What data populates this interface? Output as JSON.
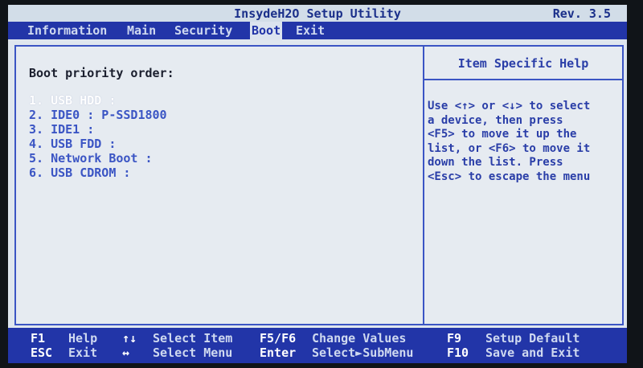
{
  "title": "InsydeH2O Setup Utility",
  "revision": "Rev. 3.5",
  "menu": {
    "tabs": [
      {
        "label": "Information",
        "active": false
      },
      {
        "label": "Main",
        "active": false
      },
      {
        "label": "Security",
        "active": false
      },
      {
        "label": "Boot",
        "active": true
      },
      {
        "label": "Exit",
        "active": false
      }
    ]
  },
  "main": {
    "heading": "Boot priority order:",
    "items": [
      {
        "label": "1. USB HDD :",
        "selected": true
      },
      {
        "label": "2. IDE0 : P-SSD1800",
        "selected": false
      },
      {
        "label": "3. IDE1 :",
        "selected": false
      },
      {
        "label": "4. USB FDD :",
        "selected": false
      },
      {
        "label": "5. Network Boot :",
        "selected": false
      },
      {
        "label": "6. USB CDROM :",
        "selected": false
      }
    ]
  },
  "help": {
    "title": "Item Specific Help",
    "text": "Use <↑> or <↓> to select\na device, then press\n<F5> to move it up the\nlist, or <F6> to move it\ndown the list. Press\n<Esc> to escape the menu"
  },
  "footer": {
    "keys": [
      {
        "key": "F1",
        "desc": "Help"
      },
      {
        "key": "ESC",
        "desc": "Exit"
      },
      {
        "key": "↑↓",
        "desc": "Select Item"
      },
      {
        "key": "↔",
        "desc": "Select Menu"
      },
      {
        "key": "F5/F6",
        "desc": "Change Values"
      },
      {
        "key": "Enter",
        "desc": "Select►SubMenu"
      },
      {
        "key": "F9",
        "desc": "Setup Default"
      },
      {
        "key": "F10",
        "desc": "Save and Exit"
      }
    ]
  },
  "colors": {
    "menu_background": "#2235a8",
    "panel_background": "#e6ebf1",
    "border": "#3b55c4",
    "item_text": "#3b55c4",
    "selected_item_text": "#ffffff",
    "title_text": "#1a2f8a"
  }
}
